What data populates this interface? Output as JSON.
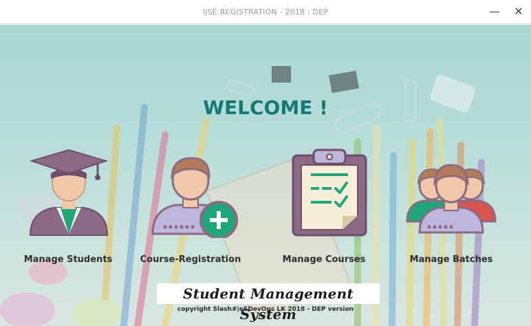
{
  "window": {
    "title": "IJSE REGISTRATION - 2018 : DEP",
    "minimize_glyph": "—",
    "close_glyph": "✕"
  },
  "main": {
    "welcome": "WELCOME !",
    "tiles": [
      {
        "label": "Manage Students",
        "icon": "graduate-student-icon"
      },
      {
        "label": "Course-Registration",
        "icon": "add-user-icon"
      },
      {
        "label": "Manage Courses",
        "icon": "clipboard-checklist-icon"
      },
      {
        "label": "Manage Batches",
        "icon": "user-group-icon"
      }
    ],
    "banner": "Student Management System",
    "copyright": "copyright Slash#|eSDevOps LK 2018 - DEP version"
  },
  "colors": {
    "welcome": "#137a76",
    "icon_purple": "#8b6a86",
    "icon_skin": "#f2c9a8",
    "icon_hair": "#b37b58",
    "icon_green": "#1fa676",
    "icon_light_purple": "#bfb6dc",
    "background": "#b6ddd8"
  }
}
